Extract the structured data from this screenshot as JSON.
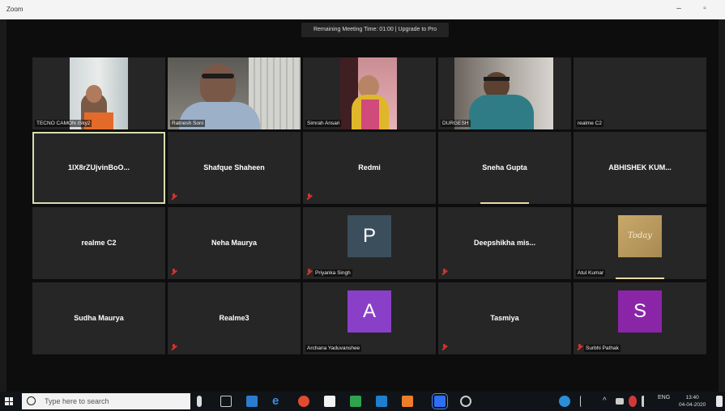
{
  "app": {
    "title": "Zoom"
  },
  "window_controls": {
    "minimize": "–",
    "maximize": "▫"
  },
  "banner": {
    "text": "Remaining Meeting Time: 01:00 | Upgrade to Pro"
  },
  "participants": {
    "row1": [
      {
        "label": "TECNO CAMON iSky2"
      },
      {
        "label": "Ratnesh Soni"
      },
      {
        "label": "Simrah Ansari"
      },
      {
        "label": "DURGESH"
      },
      {
        "label": "realme C2"
      }
    ],
    "row2": [
      {
        "name": "1lX8rZUjvinBoO..."
      },
      {
        "name": "Shafque Shaheen"
      },
      {
        "name": "Redmi"
      },
      {
        "name": "Sneha Gupta"
      },
      {
        "name": "ABHISHEK KUM..."
      }
    ],
    "row3": [
      {
        "name": "realme C2"
      },
      {
        "name": "Neha Maurya"
      },
      {
        "initial": "P",
        "label": "Priyanka Singh"
      },
      {
        "name": "Deepshikha mis..."
      },
      {
        "label": "Atul Kumar",
        "image_text": "Today"
      }
    ],
    "row4": [
      {
        "name": "Sudha Maurya"
      },
      {
        "name": "Realme3"
      },
      {
        "initial": "A",
        "label": "Archana Yaduvanshee"
      },
      {
        "name": "Tasmiya"
      },
      {
        "initial": "S",
        "label": "Surbhi Pathak"
      }
    ]
  },
  "colors": {
    "avatar_p": "#3b4e5c",
    "avatar_a": "#8a3fc9",
    "avatar_s": "#8a25a8",
    "active_border": "#d6ddb0"
  },
  "taskbar": {
    "search_placeholder": "Type here to search",
    "tray_lang": "ENG",
    "time": "13:40",
    "date": "04-04-2020"
  }
}
